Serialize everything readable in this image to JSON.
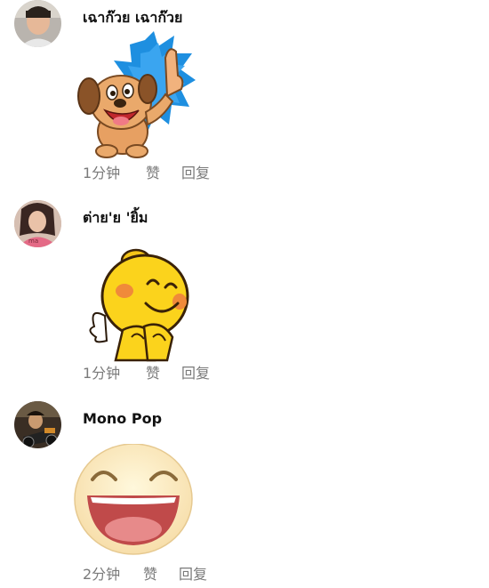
{
  "comments": [
    {
      "author": "เฉาก๊วย เฉาก๊วย",
      "sticker": "dog-thumbs-up-sticker",
      "time": "1分钟",
      "like_label": "赞",
      "reply_label": "回复"
    },
    {
      "author": "ต่าย'ย 'ยิ้ม",
      "sticker": "yellow-bear-blushing-sticker",
      "time": "1分钟",
      "like_label": "赞",
      "reply_label": "回复"
    },
    {
      "author": "Mono Pop",
      "sticker": "laughing-face-emoji",
      "time": "2分钟",
      "like_label": "赞",
      "reply_label": "回复"
    }
  ]
}
